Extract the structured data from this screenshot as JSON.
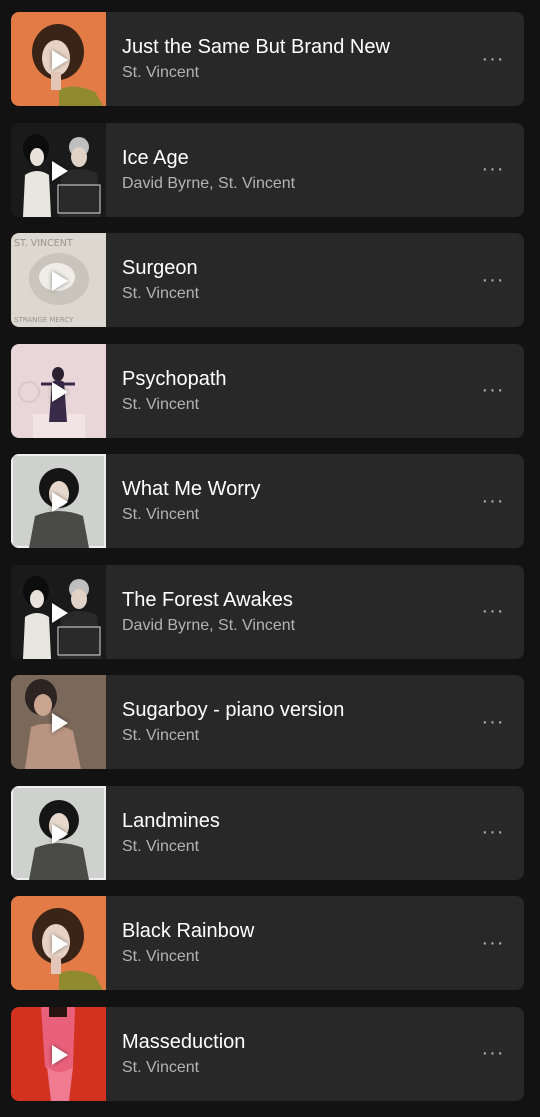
{
  "tracks": [
    {
      "title": "Just the Same But Brand New",
      "artist": "St. Vincent",
      "art": "orange-portrait"
    },
    {
      "title": "Ice Age",
      "artist": "David Byrne, St. Vincent",
      "art": "love-this-giant"
    },
    {
      "title": "Surgeon",
      "artist": "St. Vincent",
      "art": "strange-mercy"
    },
    {
      "title": "Psychopath",
      "artist": "St. Vincent",
      "art": "pink-throne"
    },
    {
      "title": "What Me Worry",
      "artist": "St. Vincent",
      "art": "grey-portrait"
    },
    {
      "title": "The Forest Awakes",
      "artist": "David Byrne, St. Vincent",
      "art": "love-this-giant"
    },
    {
      "title": "Sugarboy - piano version",
      "artist": "St. Vincent",
      "art": "sepia-portrait"
    },
    {
      "title": "Landmines",
      "artist": "St. Vincent",
      "art": "grey-portrait"
    },
    {
      "title": "Black Rainbow",
      "artist": "St. Vincent",
      "art": "orange-portrait"
    },
    {
      "title": "Masseduction",
      "artist": "St. Vincent",
      "art": "red-masseduction"
    }
  ],
  "album_art_text": {
    "strange_mercy_top": "ST. VINCENT",
    "strange_mercy_bottom": "STRANGE MERCY"
  },
  "more_icon_glyph": "···",
  "colors": {
    "background": "#121212",
    "card": "#282828",
    "title": "#ffffff",
    "subtitle": "#b3b3b3"
  }
}
